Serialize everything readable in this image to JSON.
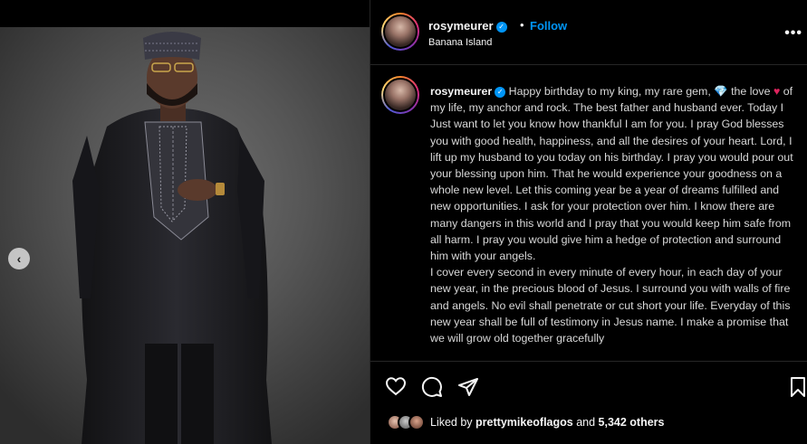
{
  "post": {
    "username": "rosymeurer",
    "verified_mark": "✓",
    "separator": "•",
    "follow_label": "Follow",
    "location": "Banana Island",
    "more_glyph": "•••",
    "caption_parts": [
      "Happy birthday to my king, my rare gem, ",
      " the love ",
      " of my life, my anchor and rock. The best father and husband ever. Today I Just want to let you know how thankful I am for you. I pray God blesses you with good health, happiness, and all the desires of your heart. Lord, I lift up my husband to you today on his birthday. I pray you would pour out your blessing upon him. That he would experience your goodness on a whole new level. Let this coming year be a year of dreams fulfilled and new opportunities. I ask for your protection over him. I know there are many dangers in this world and I pray that you would keep him safe from all harm. I pray you would give him a hedge of protection and surround him with your angels.",
      "I cover every second in every minute of every hour, in each day of your new year, in the precious blood of Jesus. I surround you with walls of fire and angels. No evil shall penetrate or cut short your life. Everyday of this new year shall be full of testimony in Jesus name. I make a promise that we will grow old together gracefully"
    ],
    "emoji_gem": "💎",
    "emoji_heart": "♥",
    "liked_by_prefix": "Liked by",
    "liked_by_user": "prettymikeoflagos",
    "liked_by_and": "and",
    "liked_by_count": "5,342 others",
    "prev_glyph": "‹"
  },
  "icons": [
    "chevron-left-icon",
    "heart-icon",
    "comment-icon",
    "share-icon",
    "bookmark-icon",
    "more-icon",
    "verified-icon"
  ],
  "colors": {
    "accent": "#0095f6",
    "background": "#000000",
    "text": "#f5f5f5",
    "heart": "#e0245e"
  }
}
